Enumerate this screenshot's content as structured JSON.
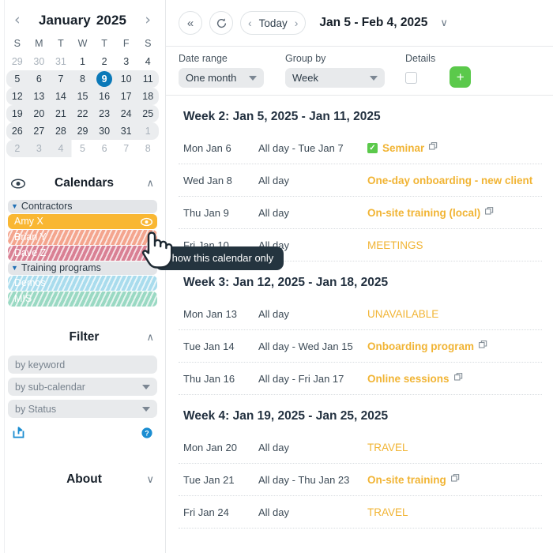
{
  "sidebar": {
    "mini_calendar": {
      "prev_label": "‹",
      "next_label": "›",
      "month": "January",
      "year": "2025",
      "dow": [
        "S",
        "M",
        "T",
        "W",
        "T",
        "F",
        "S"
      ],
      "weeks": [
        {
          "highlight": "none",
          "days": [
            {
              "n": "29",
              "muted": true
            },
            {
              "n": "30",
              "muted": true
            },
            {
              "n": "31",
              "muted": true
            },
            {
              "n": "1"
            },
            {
              "n": "2"
            },
            {
              "n": "3"
            },
            {
              "n": "4"
            }
          ]
        },
        {
          "highlight": "full",
          "days": [
            {
              "n": "5"
            },
            {
              "n": "6"
            },
            {
              "n": "7"
            },
            {
              "n": "8"
            },
            {
              "n": "9",
              "today": true
            },
            {
              "n": "10"
            },
            {
              "n": "11"
            }
          ]
        },
        {
          "highlight": "full",
          "days": [
            {
              "n": "12"
            },
            {
              "n": "13"
            },
            {
              "n": "14"
            },
            {
              "n": "15"
            },
            {
              "n": "16"
            },
            {
              "n": "17"
            },
            {
              "n": "18"
            }
          ]
        },
        {
          "highlight": "full",
          "days": [
            {
              "n": "19"
            },
            {
              "n": "20"
            },
            {
              "n": "21"
            },
            {
              "n": "22"
            },
            {
              "n": "23"
            },
            {
              "n": "24"
            },
            {
              "n": "25"
            }
          ]
        },
        {
          "highlight": "full",
          "days": [
            {
              "n": "26"
            },
            {
              "n": "27"
            },
            {
              "n": "28"
            },
            {
              "n": "29"
            },
            {
              "n": "30"
            },
            {
              "n": "31"
            },
            {
              "n": "1",
              "muted": true
            }
          ]
        },
        {
          "highlight": "partial",
          "days": [
            {
              "n": "2",
              "muted": true
            },
            {
              "n": "3",
              "muted": true
            },
            {
              "n": "4",
              "muted": true
            },
            {
              "n": "5",
              "muted": true
            },
            {
              "n": "6",
              "muted": true
            },
            {
              "n": "7",
              "muted": true
            },
            {
              "n": "8",
              "muted": true
            }
          ]
        }
      ]
    },
    "collapse_label": "‹",
    "calendars": {
      "title": "Calendars",
      "eye_icon": "eye-icon",
      "chevron": "∧",
      "groups": [
        {
          "label": "Contractors",
          "items": [
            {
              "label": "Amy X",
              "color": "#f9b733",
              "hidden": false,
              "active": true
            },
            {
              "label": "Brian Y",
              "color": "#f4a58e",
              "hidden": true,
              "active": false
            },
            {
              "label": "Dave Z",
              "color": "#d98094",
              "hidden": true,
              "active": false
            }
          ]
        },
        {
          "label": "Training programs",
          "items": [
            {
              "label": "Demos",
              "color": "#a9dced",
              "hidden": true,
              "active": false
            },
            {
              "label": "MIS",
              "color": "#9ad9c3",
              "hidden": true,
              "active": false
            }
          ]
        }
      ]
    },
    "filter": {
      "title": "Filter",
      "chevron": "∧",
      "keyword_placeholder": "by keyword",
      "subcalendar_label": "by sub-calendar",
      "status_label": "by Status",
      "share_icon": "share-icon",
      "help_icon": "help-icon"
    },
    "about": {
      "title": "About",
      "chevron": "∨"
    }
  },
  "topbar": {
    "collapse_icon": "«",
    "refresh_icon": "↻",
    "prev_icon": "‹",
    "today_label": "Today",
    "next_icon": "›",
    "range_title": "Jan 5 - Feb 4, 2025",
    "range_caret": "∨"
  },
  "controls": {
    "date_range_label": "Date range",
    "date_range_value": "One month",
    "group_by_label": "Group by",
    "group_by_value": "Week",
    "details_label": "Details",
    "details_checked": false,
    "add_label": "+",
    "add_color": "#5bc94b"
  },
  "tooltip": {
    "text": "Show this calendar only"
  },
  "agenda": {
    "event_color": "#f1b434",
    "weeks": [
      {
        "title": "Week 2: Jan 5, 2025 - Jan 11, 2025",
        "rows": [
          {
            "day": "Mon Jan 6",
            "when": "All day - Tue Jan 7",
            "name": "Seminar",
            "check": true,
            "repeat": true,
            "bold": true
          },
          {
            "day": "Wed Jan 8",
            "when": "All day",
            "name": "One-day onboarding - new client",
            "check": false,
            "repeat": false,
            "bold": true
          },
          {
            "day": "Thu Jan 9",
            "when": "All day",
            "name": "On-site training (local)",
            "check": false,
            "repeat": true,
            "bold": true
          },
          {
            "day": "Fri Jan 10",
            "when": "All day",
            "name": "MEETINGS",
            "check": false,
            "repeat": false,
            "bold": false
          }
        ]
      },
      {
        "title": "Week 3: Jan 12, 2025 - Jan 18, 2025",
        "rows": [
          {
            "day": "Mon Jan 13",
            "when": "All day",
            "name": "UNAVAILABLE",
            "check": false,
            "repeat": false,
            "bold": false
          },
          {
            "day": "Tue Jan 14",
            "when": "All day - Wed Jan 15",
            "name": "Onboarding program",
            "check": false,
            "repeat": true,
            "bold": true
          },
          {
            "day": "Thu Jan 16",
            "when": "All day - Fri Jan 17",
            "name": "Online sessions",
            "check": false,
            "repeat": true,
            "bold": true
          }
        ]
      },
      {
        "title": "Week 4: Jan 19, 2025 - Jan 25, 2025",
        "rows": [
          {
            "day": "Mon Jan 20",
            "when": "All day",
            "name": "TRAVEL",
            "check": false,
            "repeat": false,
            "bold": false
          },
          {
            "day": "Tue Jan 21",
            "when": "All day - Thu Jan 23",
            "name": "On-site training",
            "check": false,
            "repeat": true,
            "bold": true
          },
          {
            "day": "Fri Jan 24",
            "when": "All day",
            "name": "TRAVEL",
            "check": false,
            "repeat": false,
            "bold": false
          }
        ]
      }
    ]
  }
}
